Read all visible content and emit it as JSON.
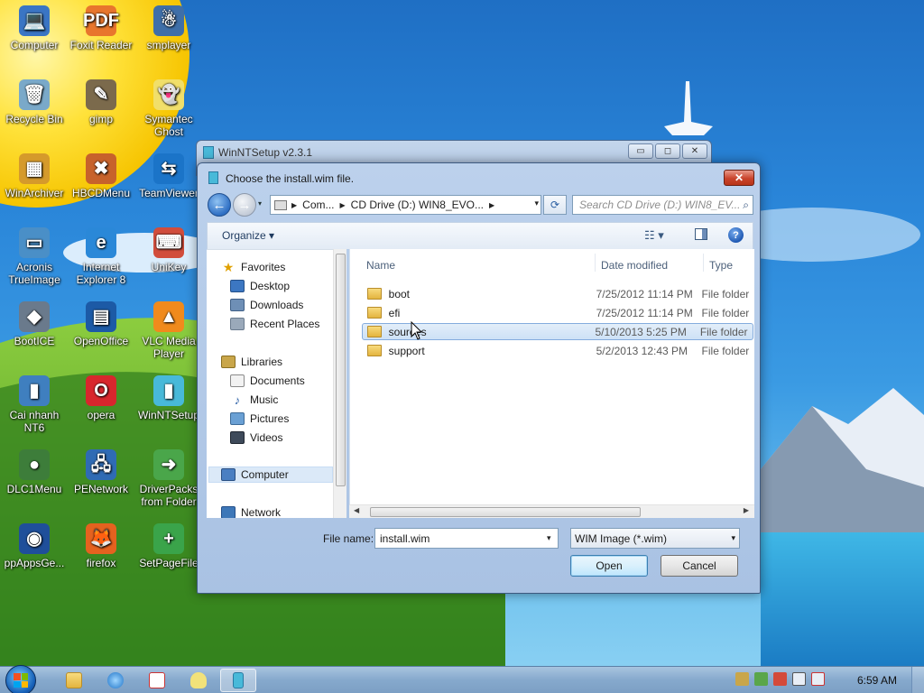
{
  "desktop": {
    "icons": [
      {
        "label": "Computer",
        "glyph": "💻",
        "color": "#3a75c4"
      },
      {
        "label": "Foxit Reader",
        "glyph": "PDF",
        "color": "#e8762d"
      },
      {
        "label": "smplayer",
        "glyph": "☃",
        "color": "#3f6fa8"
      },
      {
        "label": "Recycle Bin",
        "glyph": "🗑",
        "color": "#7aa9c9"
      },
      {
        "label": "gimp",
        "glyph": "✎",
        "color": "#7b6a4c"
      },
      {
        "label": "Symantec Ghost",
        "glyph": "👻",
        "color": "#f1df6a"
      },
      {
        "label": "WinArchiver",
        "glyph": "▦",
        "color": "#d59a2b"
      },
      {
        "label": "HBCDMenu",
        "glyph": "✖",
        "color": "#c7622b"
      },
      {
        "label": "TeamViewer",
        "glyph": "⇆",
        "color": "#1b74c8"
      },
      {
        "label": "Acronis TrueImage",
        "glyph": "▭",
        "color": "#4a8fc7"
      },
      {
        "label": "Internet Explorer 8",
        "glyph": "e",
        "color": "#2a88d8"
      },
      {
        "label": "UniKey",
        "glyph": "⌨",
        "color": "#d14d3c"
      },
      {
        "label": "BootICE",
        "glyph": "◆",
        "color": "#6a7a8c"
      },
      {
        "label": "OpenOffice",
        "glyph": "▤",
        "color": "#1c5aa6"
      },
      {
        "label": "VLC Media Player",
        "glyph": "▲",
        "color": "#f08a1c"
      },
      {
        "label": "Cai nhanh NT6",
        "glyph": "▮",
        "color": "#3f7fbf"
      },
      {
        "label": "opera",
        "glyph": "O",
        "color": "#d8262d"
      },
      {
        "label": "WinNTSetup",
        "glyph": "▮",
        "color": "#48b9d9"
      },
      {
        "label": "DLC1Menu",
        "glyph": "●",
        "color": "#3d7d3a"
      },
      {
        "label": "PENetwork",
        "glyph": "🖧",
        "color": "#2f6bb4"
      },
      {
        "label": "DriverPacks from Folder",
        "glyph": "➜",
        "color": "#4aa64a"
      },
      {
        "label": "ppAppsGe...",
        "glyph": "◉",
        "color": "#1f4f9a"
      },
      {
        "label": "firefox",
        "glyph": "🦊",
        "color": "#e5621f"
      },
      {
        "label": "SetPageFile",
        "glyph": "+",
        "color": "#3aa44a"
      }
    ]
  },
  "back_window": {
    "title": "WinNTSetup v2.3.1",
    "minimize": "▭",
    "restore": "◻",
    "close": "✕"
  },
  "dialog": {
    "title": "Choose the install.wim file.",
    "close": "✕",
    "back": "←",
    "forward": "→",
    "recent": "▾",
    "address": {
      "crumbs": [
        "Com...",
        "CD Drive (D:) WIN8_EVO..."
      ],
      "sep": "▶",
      "dropdown": "▾"
    },
    "refresh": "⟳",
    "search_placeholder": "Search CD Drive (D:) WIN8_EV...",
    "search_icon": "⌕",
    "toolbar": {
      "organize": "Organize ▾",
      "views": "☷ ▾",
      "help": "?"
    },
    "nav": {
      "favorites": "Favorites",
      "desktop": "Desktop",
      "downloads": "Downloads",
      "recent_places": "Recent Places",
      "libraries": "Libraries",
      "documents": "Documents",
      "music": "Music",
      "pictures": "Pictures",
      "videos": "Videos",
      "computer": "Computer",
      "network": "Network"
    },
    "columns": {
      "name": "Name",
      "date": "Date modified",
      "type": "Type"
    },
    "files": [
      {
        "name": "boot",
        "date": "7/25/2012 11:14 PM",
        "type": "File folder"
      },
      {
        "name": "efi",
        "date": "7/25/2012 11:14 PM",
        "type": "File folder"
      },
      {
        "name": "sources",
        "date": "5/10/2013 5:25 PM",
        "type": "File folder"
      },
      {
        "name": "support",
        "date": "5/2/2013 12:43 PM",
        "type": "File folder"
      }
    ],
    "filename_label": "File name:",
    "filename_value": "install.wim",
    "filetype_value": "WIM Image (*.wim)",
    "dd_arrow": "▾",
    "open_label": "Open",
    "cancel_label": "Cancel",
    "scroll_left": "◀",
    "scroll_right": "▶"
  },
  "taskbar": {
    "clock": "6:59 AM"
  },
  "colors": {
    "accent": "#3c7fb1",
    "selection": "#cde1f6"
  }
}
